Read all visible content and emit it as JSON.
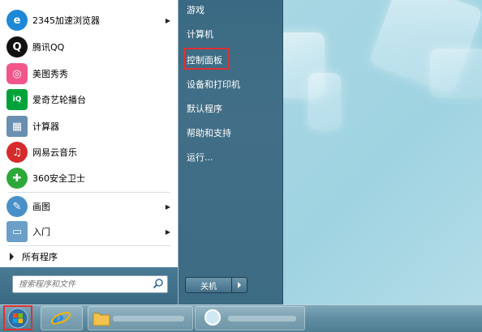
{
  "programs": [
    {
      "label": "2345加速浏览器",
      "icon": "browser-2345-icon",
      "color": "#1e88d8",
      "arrow": true
    },
    {
      "label": "腾讯QQ",
      "icon": "qq-penguin-icon",
      "color": "#111111",
      "arrow": false
    },
    {
      "label": "美图秀秀",
      "icon": "meitu-icon",
      "color": "#f2558a",
      "arrow": false
    },
    {
      "label": "爱奇艺轮播台",
      "icon": "iqiyi-icon",
      "color": "#00a33a",
      "arrow": false
    },
    {
      "label": "计算器",
      "icon": "calculator-icon",
      "color": "#6a8fb0",
      "arrow": false
    },
    {
      "label": "网易云音乐",
      "icon": "netease-music-icon",
      "color": "#d62b2b",
      "arrow": false
    },
    {
      "label": "360安全卫士",
      "icon": "360-safe-icon",
      "color": "#2fa83a",
      "arrow": false
    },
    {
      "label": "画图",
      "icon": "paint-icon",
      "color": "#4a90c8",
      "arrow": true
    },
    {
      "label": "入门",
      "icon": "getting-started-icon",
      "color": "#6aa0c8",
      "arrow": true
    }
  ],
  "all_programs": "所有程序",
  "search": {
    "placeholder": "搜索程序和文件"
  },
  "right_items": [
    "游戏",
    "计算机",
    "控制面板",
    "设备和打印机",
    "默认程序",
    "帮助和支持",
    "运行..."
  ],
  "shutdown": {
    "label": "关机"
  },
  "highlight_color": "#e03030"
}
